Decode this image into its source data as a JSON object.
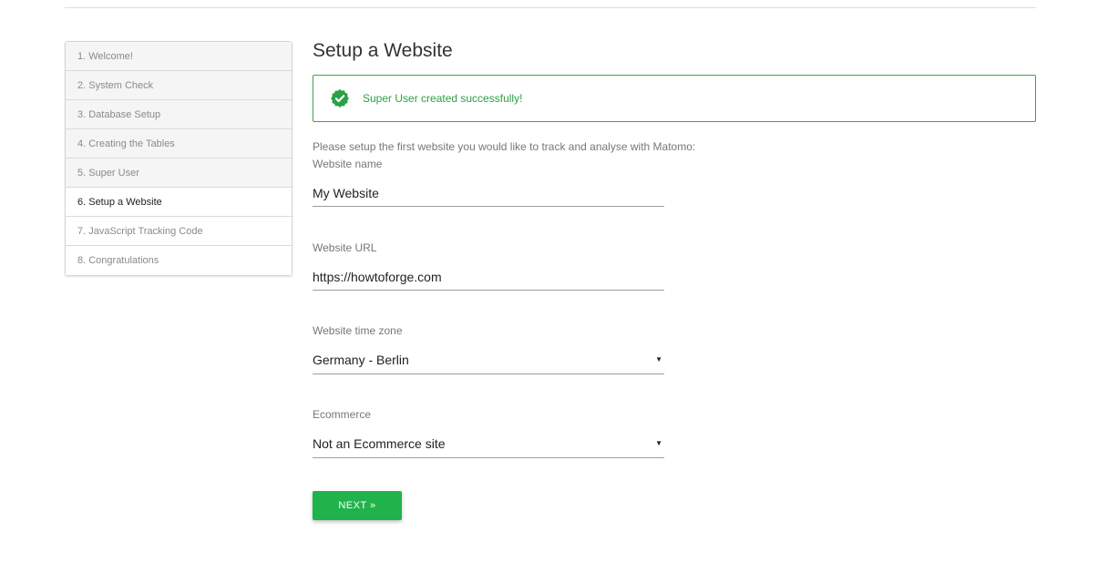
{
  "steps": [
    {
      "label": "1. Welcome!",
      "state": "done"
    },
    {
      "label": "2. System Check",
      "state": "done"
    },
    {
      "label": "3. Database Setup",
      "state": "done"
    },
    {
      "label": "4. Creating the Tables",
      "state": "done"
    },
    {
      "label": "5. Super User",
      "state": "done"
    },
    {
      "label": "6. Setup a Website",
      "state": "current"
    },
    {
      "label": "7. JavaScript Tracking Code",
      "state": "future"
    },
    {
      "label": "8. Congratulations",
      "state": "future"
    }
  ],
  "main": {
    "title": "Setup a Website",
    "success_message": "Super User created successfully!",
    "intro": "Please setup the first website you would like to track and analyse with Matomo:"
  },
  "form": {
    "website_name": {
      "label": "Website name",
      "value": "My Website"
    },
    "website_url": {
      "label": "Website URL",
      "value": "https://howtoforge.com"
    },
    "timezone": {
      "label": "Website time zone",
      "value": "Germany - Berlin"
    },
    "ecommerce": {
      "label": "Ecommerce",
      "value": "Not an Ecommerce site"
    },
    "dropdown_glyph": "▼"
  },
  "actions": {
    "next_label": "NEXT »"
  },
  "colors": {
    "accent_green": "#21b34b",
    "success_text": "#2ca045",
    "success_border": "#43a047"
  },
  "icons": {
    "success": "check-badge-icon",
    "dropdown": "caret-down-icon"
  }
}
